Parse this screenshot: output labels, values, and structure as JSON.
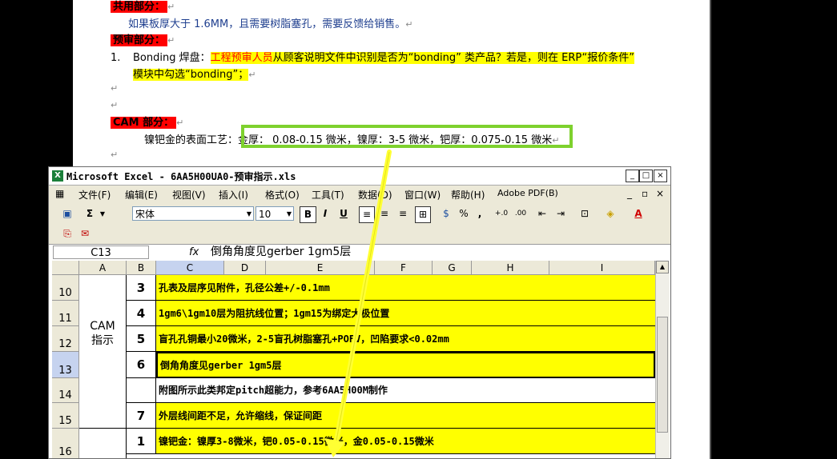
{
  "document": {
    "section_shared": "共用部分：",
    "shared_note": "如果板厚大于 1.6MM，且需要树脂塞孔，需要反馈给销售。",
    "section_review": "预审部分：",
    "item1_num": "1.",
    "item1_prefix": "Bonding 焊盘：",
    "item1_role": "工程预审人员",
    "item1_text": "从顾客说明文件中识别是否为“bonding” 类产品？若是，则在 ERP“报价条件”",
    "item1_cont": "模块中勾选“bonding”；",
    "section_cam": "CAM 部分：",
    "finish_label": "镍钯金的表面工艺：",
    "finish_value": "金厚： 0.08-0.15 微米，镍厚：3-5 微米，钯厚：0.075-0.15 微米",
    "para_mark": "↵"
  },
  "excel": {
    "title": "Microsoft Excel - 6AA5H00UA0-预审指示.xls",
    "menu": [
      "文件(F)",
      "编辑(E)",
      "视图(V)",
      "插入(I)",
      "格式(O)",
      "工具(T)",
      "数据(D)",
      "窗口(W)",
      "帮助(H)",
      "Adobe PDF(B)"
    ],
    "font_name": "宋体",
    "font_size": "10",
    "font_size2": "10",
    "toolbar_labels": {
      "bold": "B",
      "italic": "I",
      "underline": "U",
      "sigma": "Σ",
      "percent": "%",
      "comma": ",",
      "inc_dec": "+.0",
      "dec_dec": ".00",
      "fontcolor": "A"
    },
    "name_box": "C13",
    "fx_label": "fx",
    "formula": "倒角角度见gerber 1gm5层",
    "columns": [
      "A",
      "B",
      "C",
      "D",
      "E",
      "F",
      "G",
      "H",
      "I"
    ],
    "group_label_line1": "CAM",
    "group_label_line2": "指示",
    "rows": [
      {
        "row": "10",
        "num": "3",
        "text": "孔表及层序见附件，孔径公差+/-0.1mm",
        "highlight": true
      },
      {
        "row": "11",
        "num": "4",
        "text": "1gm6\\1gm10层为阻抗线位置；1gm15为绑定大极位置",
        "highlight": true
      },
      {
        "row": "12",
        "num": "5",
        "text": "盲孔孔铜最小20微米，2-5盲孔树脂塞孔+POFV，凹陷要求<0.02mm",
        "highlight": true
      },
      {
        "row": "13",
        "num": "6",
        "text": "倒角角度见gerber 1gm5层",
        "highlight": true
      },
      {
        "row": "14",
        "num": "",
        "text": "附图所示此类邦定pitch超能力，参考6AA5H00M制作",
        "highlight": false
      },
      {
        "row": "15",
        "num": "7",
        "text": "外层线间距不足，允许缩线，保证间距",
        "highlight": true
      },
      {
        "row": "16",
        "num": "1",
        "text": "镍钯金：镍厚3-8微米，钯0.05-0.15微米，金0.05-0.15微米",
        "highlight": true
      }
    ],
    "colors": {
      "highlight": "#ffff00",
      "header": "#ece9d8",
      "annotation_green": "#7ed12e",
      "arrow_yellow": "#ffff33"
    }
  }
}
